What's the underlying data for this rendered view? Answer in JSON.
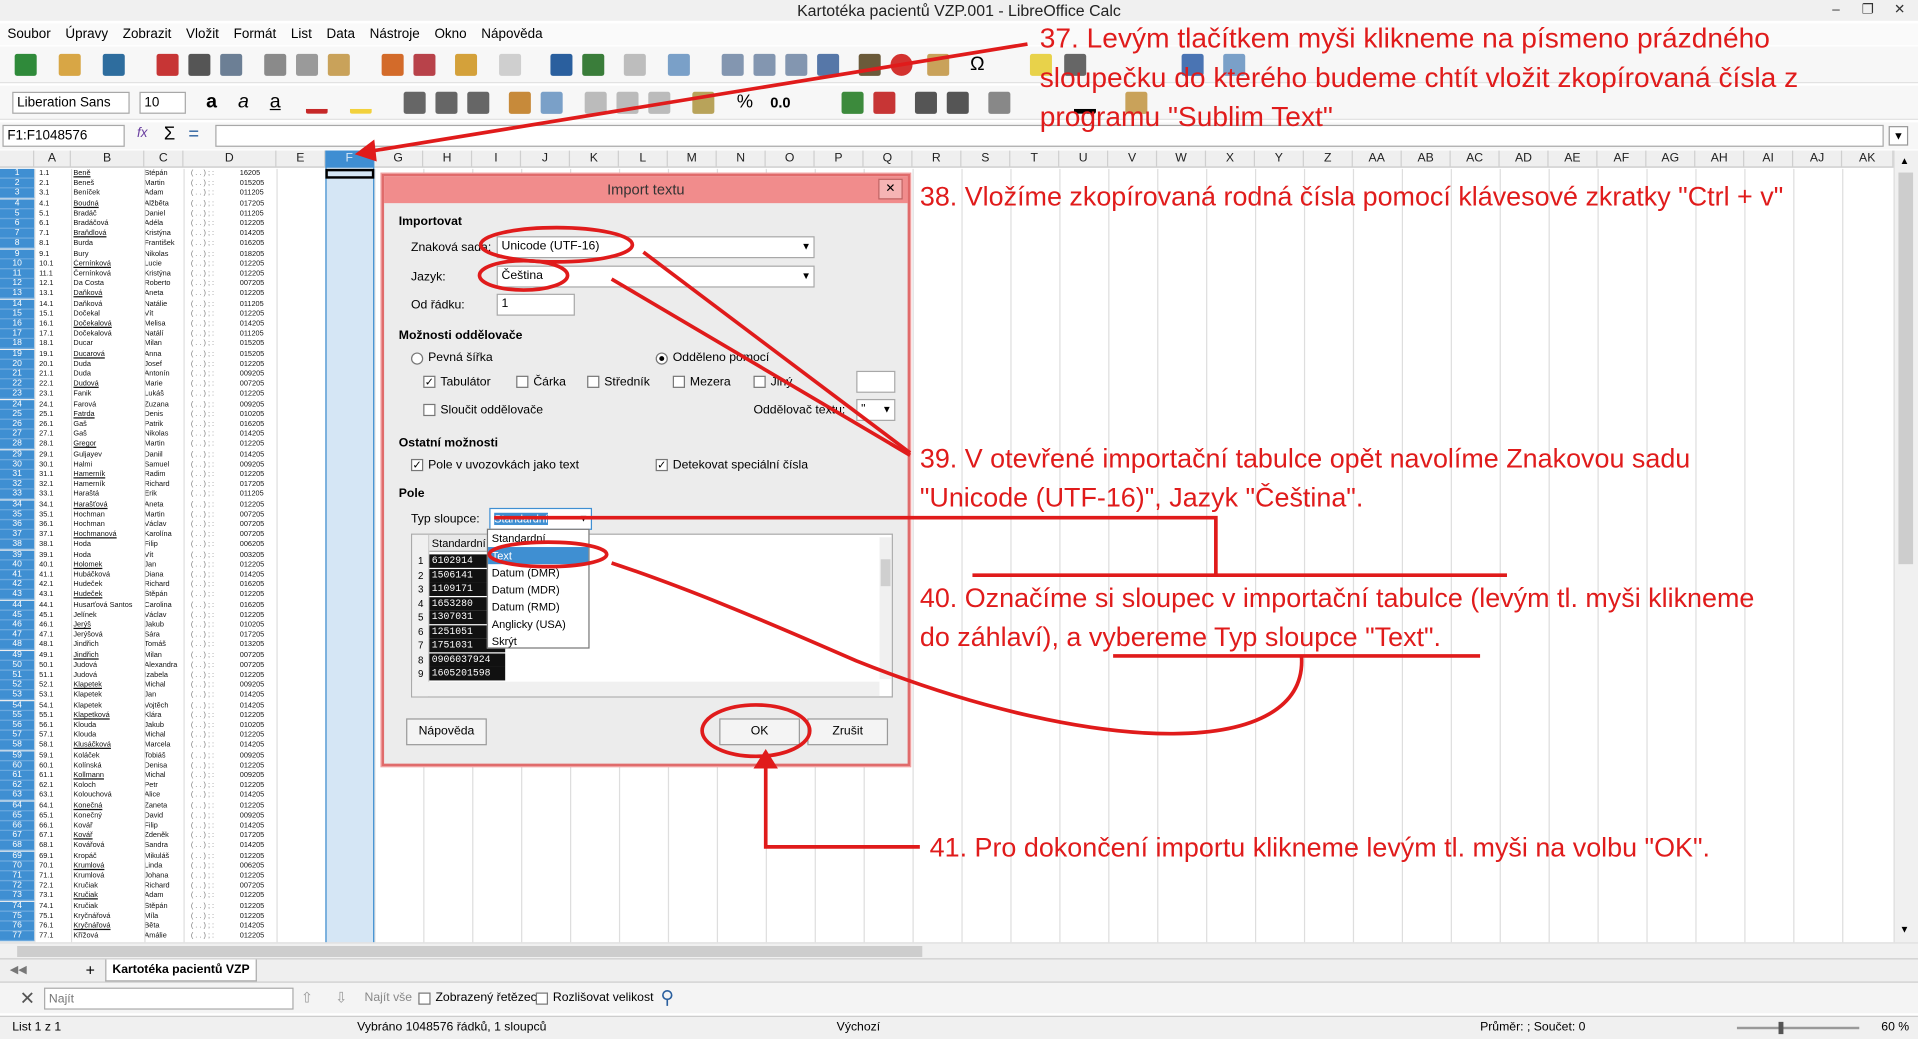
{
  "window": {
    "title": "Kartotéka pacientů VZP.001 - LibreOffice Calc",
    "minimize_label": "–",
    "restore_label": "❐",
    "close_label": "✕"
  },
  "menu": [
    "Soubor",
    "Úpravy",
    "Zobrazit",
    "Vložit",
    "Formát",
    "List",
    "Data",
    "Nástroje",
    "Okno",
    "Nápověda"
  ],
  "format_toolbar": {
    "font_name": "Liberation Sans",
    "font_size": "10",
    "percent_label": "%",
    "decimal_label": "0.0"
  },
  "formula_bar": {
    "name_box": "F1:F1048576",
    "sum_symbol": "Σ",
    "equals_symbol": "=",
    "func_symbol": "fx"
  },
  "columns": [
    "A",
    "B",
    "C",
    "D",
    "E",
    "F",
    "G",
    "H",
    "I",
    "J",
    "K",
    "L",
    "M",
    "N",
    "O",
    "P",
    "Q",
    "R",
    "S",
    "T",
    "U",
    "V",
    "W",
    "X",
    "Y",
    "Z",
    "AA",
    "AB",
    "AC",
    "AD",
    "AE",
    "AF",
    "AG",
    "AH",
    "AI",
    "AJ",
    "AK"
  ],
  "sheet": {
    "rows": [
      {
        "num": "1",
        "a": "1.1",
        "b": "Beně",
        "c": "Stépán",
        "e": "16205"
      },
      {
        "num": "2",
        "a": "2.1",
        "b": "Beneš",
        "c": "Martin",
        "e": "015205"
      },
      {
        "num": "3",
        "a": "3.1",
        "b": "Beníček",
        "c": "Adam",
        "e": "011205"
      },
      {
        "num": "4",
        "a": "4.1",
        "b": "Boudná",
        "c": "Alžběta",
        "e": "017205"
      },
      {
        "num": "5",
        "a": "5.1",
        "b": "Bradáč",
        "c": "Daniel",
        "e": "011205"
      },
      {
        "num": "6",
        "a": "6.1",
        "b": "Bradáčová",
        "c": "Adéla",
        "e": "012205"
      },
      {
        "num": "7",
        "a": "7.1",
        "b": "Braňdlová",
        "c": "Kristýna",
        "e": "014205"
      },
      {
        "num": "8",
        "a": "8.1",
        "b": "Burda",
        "c": "František",
        "e": "016205"
      },
      {
        "num": "9",
        "a": "9.1",
        "b": "Bury",
        "c": "Nikolas",
        "e": "018205"
      },
      {
        "num": "10",
        "a": "10.1",
        "b": "Černínková",
        "c": "Lucie",
        "e": "012205"
      },
      {
        "num": "11",
        "a": "11.1",
        "b": "Černínková",
        "c": "Kristýna",
        "e": "012205"
      },
      {
        "num": "12",
        "a": "12.1",
        "b": "Da Costa",
        "c": "Roberto",
        "e": "007205"
      },
      {
        "num": "13",
        "a": "13.1",
        "b": "Daňková",
        "c": "Aneta",
        "e": "012205"
      },
      {
        "num": "14",
        "a": "14.1",
        "b": "Daňková",
        "c": "Natálie",
        "e": "011205"
      },
      {
        "num": "15",
        "a": "15.1",
        "b": "Dočekal",
        "c": "Vít",
        "e": "012205"
      },
      {
        "num": "16",
        "a": "16.1",
        "b": "Dočekalová",
        "c": "Melisa",
        "e": "014205"
      },
      {
        "num": "17",
        "a": "17.1",
        "b": "Dočekalová",
        "c": "Natálí",
        "e": "011205"
      },
      {
        "num": "18",
        "a": "18.1",
        "b": "Ducar",
        "c": "Milan",
        "e": "015205"
      },
      {
        "num": "19",
        "a": "19.1",
        "b": "Ducarová",
        "c": "Anna",
        "e": "015205"
      },
      {
        "num": "20",
        "a": "20.1",
        "b": "Duda",
        "c": "Josef",
        "e": "012205"
      },
      {
        "num": "21",
        "a": "21.1",
        "b": "Duda",
        "c": "Antonín",
        "e": "009205"
      },
      {
        "num": "22",
        "a": "22.1",
        "b": "Dudová",
        "c": "Marie",
        "e": "007205"
      },
      {
        "num": "23",
        "a": "23.1",
        "b": "Fanik",
        "c": "Lukáš",
        "e": "012205"
      },
      {
        "num": "24",
        "a": "24.1",
        "b": "Farová",
        "c": "Zuzana",
        "e": "009205"
      },
      {
        "num": "25",
        "a": "25.1",
        "b": "Fatrda",
        "c": "Denis",
        "e": "010205"
      },
      {
        "num": "26",
        "a": "26.1",
        "b": "Gaš",
        "c": "Patrik",
        "e": "016205"
      },
      {
        "num": "27",
        "a": "27.1",
        "b": "Gaš",
        "c": "Nikolas",
        "e": "014205"
      },
      {
        "num": "28",
        "a": "28.1",
        "b": "Gregor",
        "c": "Martin",
        "e": "012205"
      },
      {
        "num": "29",
        "a": "29.1",
        "b": "Guljayev",
        "c": "Daniil",
        "e": "014205"
      },
      {
        "num": "30",
        "a": "30.1",
        "b": "Halmi",
        "c": "Samuel",
        "e": "009205"
      },
      {
        "num": "31",
        "a": "31.1",
        "b": "Hamerník",
        "c": "Radim",
        "e": "012205"
      },
      {
        "num": "32",
        "a": "32.1",
        "b": "Hamerník",
        "c": "Richard",
        "e": "017205"
      },
      {
        "num": "33",
        "a": "33.1",
        "b": "Haraštá",
        "c": "Erik",
        "e": "011205"
      },
      {
        "num": "34",
        "a": "34.1",
        "b": "Harašťová",
        "c": "Aneta",
        "e": "012205"
      },
      {
        "num": "35",
        "a": "35.1",
        "b": "Hochman",
        "c": "Martin",
        "e": "007205"
      },
      {
        "num": "36",
        "a": "36.1",
        "b": "Hochman",
        "c": "Václav",
        "e": "007205"
      },
      {
        "num": "37",
        "a": "37.1",
        "b": "Hochmanová",
        "c": "Karolína",
        "e": "007205"
      },
      {
        "num": "38",
        "a": "38.1",
        "b": "Hoda",
        "c": "Filip",
        "e": "006205"
      },
      {
        "num": "39",
        "a": "39.1",
        "b": "Hoda",
        "c": "Vít",
        "e": "003205"
      },
      {
        "num": "40",
        "a": "40.1",
        "b": "Holomek",
        "c": "Jan",
        "e": "012205"
      },
      {
        "num": "41",
        "a": "41.1",
        "b": "Hubáčková",
        "c": "Diana",
        "e": "014205"
      },
      {
        "num": "42",
        "a": "42.1",
        "b": "Hudeček",
        "c": "Richard",
        "e": "016205"
      },
      {
        "num": "43",
        "a": "43.1",
        "b": "Hudeček",
        "c": "Štěpán",
        "e": "012205"
      },
      {
        "num": "44",
        "a": "44.1",
        "b": "Husarťová Santos",
        "c": "Carolina",
        "e": "016205"
      },
      {
        "num": "45",
        "a": "45.1",
        "b": "Jelínek",
        "c": "Václav",
        "e": "012205"
      },
      {
        "num": "46",
        "a": "46.1",
        "b": "Jerýš",
        "c": "Jakub",
        "e": "010205"
      },
      {
        "num": "47",
        "a": "47.1",
        "b": "Jerýšová",
        "c": "Sára",
        "e": "017205"
      },
      {
        "num": "48",
        "a": "48.1",
        "b": "Jindřich",
        "c": "Tomáš",
        "e": "013205"
      },
      {
        "num": "49",
        "a": "49.1",
        "b": "Jindřich",
        "c": "Milan",
        "e": "007205"
      },
      {
        "num": "50",
        "a": "50.1",
        "b": "Judová",
        "c": "Alexandra",
        "e": "007205"
      },
      {
        "num": "51",
        "a": "51.1",
        "b": "Judová",
        "c": "Izabela",
        "e": "012205"
      },
      {
        "num": "52",
        "a": "52.1",
        "b": "Klapetek",
        "c": "Michal",
        "e": "009205"
      },
      {
        "num": "53",
        "a": "53.1",
        "b": "Klapetek",
        "c": "Jan",
        "e": "014205"
      },
      {
        "num": "54",
        "a": "54.1",
        "b": "Klapetek",
        "c": "Vojtěch",
        "e": "014205"
      },
      {
        "num": "55",
        "a": "55.1",
        "b": "Klapetková",
        "c": "Klára",
        "e": "012205"
      },
      {
        "num": "56",
        "a": "56.1",
        "b": "Klouda",
        "c": "Jakub",
        "e": "010205"
      },
      {
        "num": "57",
        "a": "57.1",
        "b": "Klouda",
        "c": "Michal",
        "e": "012205"
      },
      {
        "num": "58",
        "a": "58.1",
        "b": "Klusáčková",
        "c": "Marcela",
        "e": "014205"
      },
      {
        "num": "59",
        "a": "59.1",
        "b": "Koláček",
        "c": "Tobiáš",
        "e": "009205"
      },
      {
        "num": "60",
        "a": "60.1",
        "b": "Kolínská",
        "c": "Denisa",
        "e": "012205"
      },
      {
        "num": "61",
        "a": "61.1",
        "b": "Kollmann",
        "c": "Michal",
        "e": "009205"
      },
      {
        "num": "62",
        "a": "62.1",
        "b": "Koloch",
        "c": "Petr",
        "e": "012205"
      },
      {
        "num": "63",
        "a": "63.1",
        "b": "Kolouchová",
        "c": "Alice",
        "e": "014205"
      },
      {
        "num": "64",
        "a": "64.1",
        "b": "Konečná",
        "c": "Zaneta",
        "e": "012205"
      },
      {
        "num": "65",
        "a": "65.1",
        "b": "Konečný",
        "c": "David",
        "e": "009205"
      },
      {
        "num": "66",
        "a": "66.1",
        "b": "Kovář",
        "c": "Filip",
        "e": "014205"
      },
      {
        "num": "67",
        "a": "67.1",
        "b": "Kovář",
        "c": "Zdeněk",
        "e": "017205"
      },
      {
        "num": "68",
        "a": "68.1",
        "b": "Kovářová",
        "c": "Sandra",
        "e": "014205"
      },
      {
        "num": "69",
        "a": "69.1",
        "b": "Kropáč",
        "c": "Mikuláš",
        "e": "012205"
      },
      {
        "num": "70",
        "a": "70.1",
        "b": "Krumlová",
        "c": "Linda",
        "e": "006205"
      },
      {
        "num": "71",
        "a": "71.1",
        "b": "Krumlová",
        "c": "Johana",
        "e": "012205"
      },
      {
        "num": "72",
        "a": "72.1",
        "b": "Kručiak",
        "c": "Richard",
        "e": "007205"
      },
      {
        "num": "73",
        "a": "73.1",
        "b": "Kručiak",
        "c": "Adam",
        "e": "012205"
      },
      {
        "num": "74",
        "a": "74.1",
        "b": "Kručiak",
        "c": "Štěpán",
        "e": "012205"
      },
      {
        "num": "75",
        "a": "75.1",
        "b": "Kryčnářová",
        "c": "Míla",
        "e": "012205"
      },
      {
        "num": "76",
        "a": "76.1",
        "b": "Kryčnářová",
        "c": "Běta",
        "e": "014205"
      },
      {
        "num": "77",
        "a": "77.1",
        "b": "Křížová",
        "c": "Amálie",
        "e": "012205"
      }
    ]
  },
  "dialog": {
    "title": "Import textu",
    "close_label": "✕",
    "section_import": "Importovat",
    "charset_label": "Znaková sada:",
    "charset_value": "Unicode (UTF-16)",
    "language_label": "Jazyk:",
    "language_value": "Čeština",
    "from_row_label": "Od řádku:",
    "from_row_value": "1",
    "section_separator": "Možnosti oddělovače",
    "fixed_width_label": "Pevná šířka",
    "separated_by_label": "Odděleno pomocí",
    "tab_label": "Tabulátor",
    "comma_label": "Čárka",
    "semicolon_label": "Středník",
    "space_label": "Mezera",
    "other_label": "Jiný",
    "merge_label": "Sloučit oddělovače",
    "text_delim_label": "Oddělovač textu:",
    "text_delim_value": "\"",
    "section_other": "Ostatní možnosti",
    "quoted_label": "Pole v uvozovkách jako text",
    "detect_label": "Detekovat speciální čísla",
    "section_fields": "Pole",
    "coltype_label": "Typ sloupce:",
    "coltype_value": "Standardní",
    "coltype_options": [
      "Standardní",
      "Text",
      "Datum (DMR)",
      "Datum (MDR)",
      "Datum (RMD)",
      "Anglicky (USA)",
      "Skrýt"
    ],
    "preview_header": "Standardní",
    "preview_rows": [
      {
        "n": "1",
        "v": "6102914"
      },
      {
        "n": "2",
        "v": "1506141"
      },
      {
        "n": "3",
        "v": "1109171"
      },
      {
        "n": "4",
        "v": "1653280"
      },
      {
        "n": "5",
        "v": "1307031"
      },
      {
        "n": "6",
        "v": "1251051"
      },
      {
        "n": "7",
        "v": "1751031"
      },
      {
        "n": "8",
        "v": "0906037924"
      },
      {
        "n": "9",
        "v": "1605201598"
      }
    ],
    "help_button": "Nápověda",
    "ok_button": "OK",
    "cancel_button": "Zrušit"
  },
  "annotations": {
    "a37": [
      "37. Levým tlačítkem myši klikneme na písmeno prázdného",
      "sloupečku do kterého budeme chtít vložit zkopírovaná čísla z",
      "programu \"Sublim Text\""
    ],
    "a38": "38. Vložíme zkopírovaná rodná čísla pomocí klávesové zkratky \"Ctrl + v\"",
    "a39": [
      "39. V otevřené importační tabulce opět navolíme Znakovou sadu",
      "\"Unicode (UTF-16)\", Jazyk \"Čeština\"."
    ],
    "a40": [
      "40. Označíme si sloupec v importační tabulce (levým tl. myši klikneme",
      "do záhlaví), a vybereme Typ sloupce \"Text\"."
    ],
    "a41": "41. Pro dokončení importu klikneme levým tl. myši na volbu \"OK\".",
    "color": "#e01b1b"
  },
  "sheet_tabs": {
    "add_label": "+",
    "active_tab": "Kartotéka pacientů VZP"
  },
  "find_bar": {
    "placeholder": "Najít",
    "find_all": "Najít vše",
    "formatted_label": "Zobrazený řetězec",
    "match_case_label": "Rozlišovat velikost"
  },
  "status": {
    "sheet": "List 1 z 1",
    "selection": "Vybráno 1048576 řádků, 1 sloupců",
    "style": "Výchozí",
    "sum": "Průměr: ; Součet: 0",
    "zoom": "60 %"
  },
  "colors": {
    "selection_blue": "#3f8fd2",
    "dialog_title": "#f18c8c",
    "annotation_red": "#e01b1b"
  }
}
